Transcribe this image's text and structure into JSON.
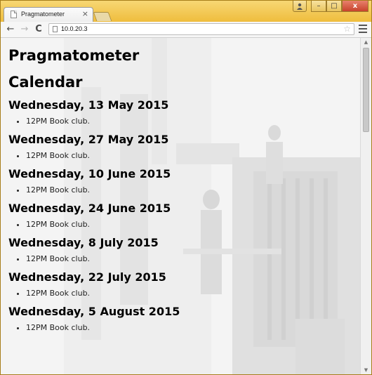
{
  "browser": {
    "tab_title": "Pragmatometer",
    "url": "10.0.20.3",
    "close_label": "×",
    "window_user_icon": "user-icon",
    "window_minimize_label": "–",
    "window_maximize_label": "□",
    "window_close_label": "x"
  },
  "nav": {
    "back_label": "←",
    "forward_label": "→",
    "reload_label": "C",
    "star_label": "☆"
  },
  "page": {
    "site_title": "Pragmatometer",
    "section_title": "Calendar",
    "days": [
      {
        "date": "Wednesday, 13 May 2015",
        "events": [
          "12PM Book club."
        ]
      },
      {
        "date": "Wednesday, 27 May 2015",
        "events": [
          "12PM Book club."
        ]
      },
      {
        "date": "Wednesday, 10 June 2015",
        "events": [
          "12PM Book club."
        ]
      },
      {
        "date": "Wednesday, 24 June 2015",
        "events": [
          "12PM Book club."
        ]
      },
      {
        "date": "Wednesday, 8 July 2015",
        "events": [
          "12PM Book club."
        ]
      },
      {
        "date": "Wednesday, 22 July 2015",
        "events": [
          "12PM Book club."
        ]
      },
      {
        "date": "Wednesday, 5 August 2015",
        "events": [
          "12PM Book club."
        ]
      }
    ]
  },
  "colors": {
    "frame": "#f0c24a",
    "page_background": "#f5f5f5",
    "heading_text": "#000000"
  }
}
